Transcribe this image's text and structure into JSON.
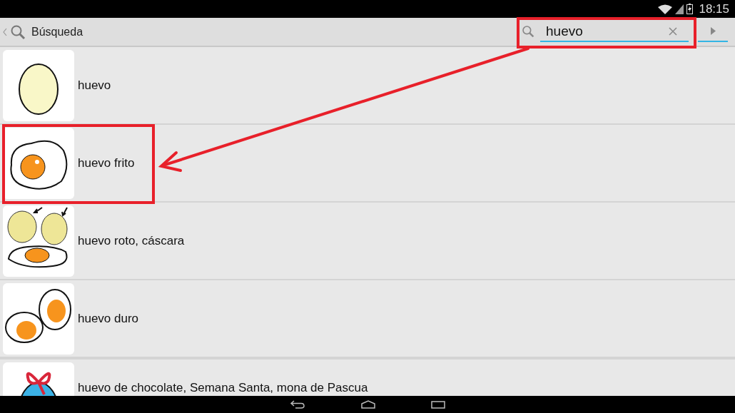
{
  "status_bar": {
    "time": "18:15"
  },
  "action_bar": {
    "title": "Búsqueda",
    "search": {
      "value": "huevo"
    }
  },
  "results": [
    {
      "kind": "egg",
      "label": "huevo"
    },
    {
      "kind": "fried-egg",
      "label": "huevo frito"
    },
    {
      "kind": "broken-egg",
      "label": "huevo roto, cáscara"
    },
    {
      "kind": "boiled-egg",
      "label": "huevo duro"
    },
    {
      "kind": "easter-egg",
      "label": "huevo de chocolate, Semana Santa, mona de Pascua"
    }
  ]
}
